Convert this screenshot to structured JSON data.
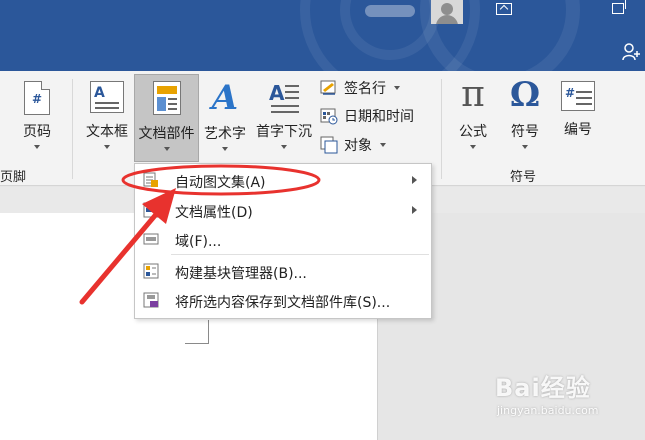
{
  "ribbon": {
    "groups": {
      "header_footer_partial": "页脚",
      "symbols": "符号"
    },
    "buttons": {
      "page_number": "页码",
      "text_box": "文本框",
      "quick_parts": "文档部件",
      "wordart": "艺术字",
      "drop_cap": "首字下沉",
      "signature_line": "签名行",
      "date_time": "日期和时间",
      "object": "对象",
      "equation": "公式",
      "symbol": "符号",
      "number": "编号"
    },
    "glyphs": {
      "wordart": "A",
      "equation": "π",
      "symbol": "Ω",
      "hash": "#",
      "letter_a": "A"
    }
  },
  "menu": {
    "items": [
      {
        "label": "自动图文集(A)",
        "has_submenu": true,
        "icon": "autotext-icon"
      },
      {
        "label": "文档属性(D)",
        "has_submenu": true,
        "icon": "document-property-icon"
      },
      {
        "label": "域(F)...",
        "has_submenu": false,
        "icon": "field-icon"
      },
      {
        "label": "构建基块管理器(B)...",
        "has_submenu": false,
        "icon": "building-blocks-icon"
      },
      {
        "label": "将所选内容保存到文档部件库(S)...",
        "has_submenu": false,
        "icon": "save-to-gallery-icon"
      }
    ]
  },
  "watermark": {
    "text": "Bai经验",
    "url": "jingyan.baidu.com"
  },
  "colors": {
    "title_bar": "#2b579a",
    "annotation_red": "#e8322e",
    "ribbon_bg": "#f3f3f3"
  }
}
